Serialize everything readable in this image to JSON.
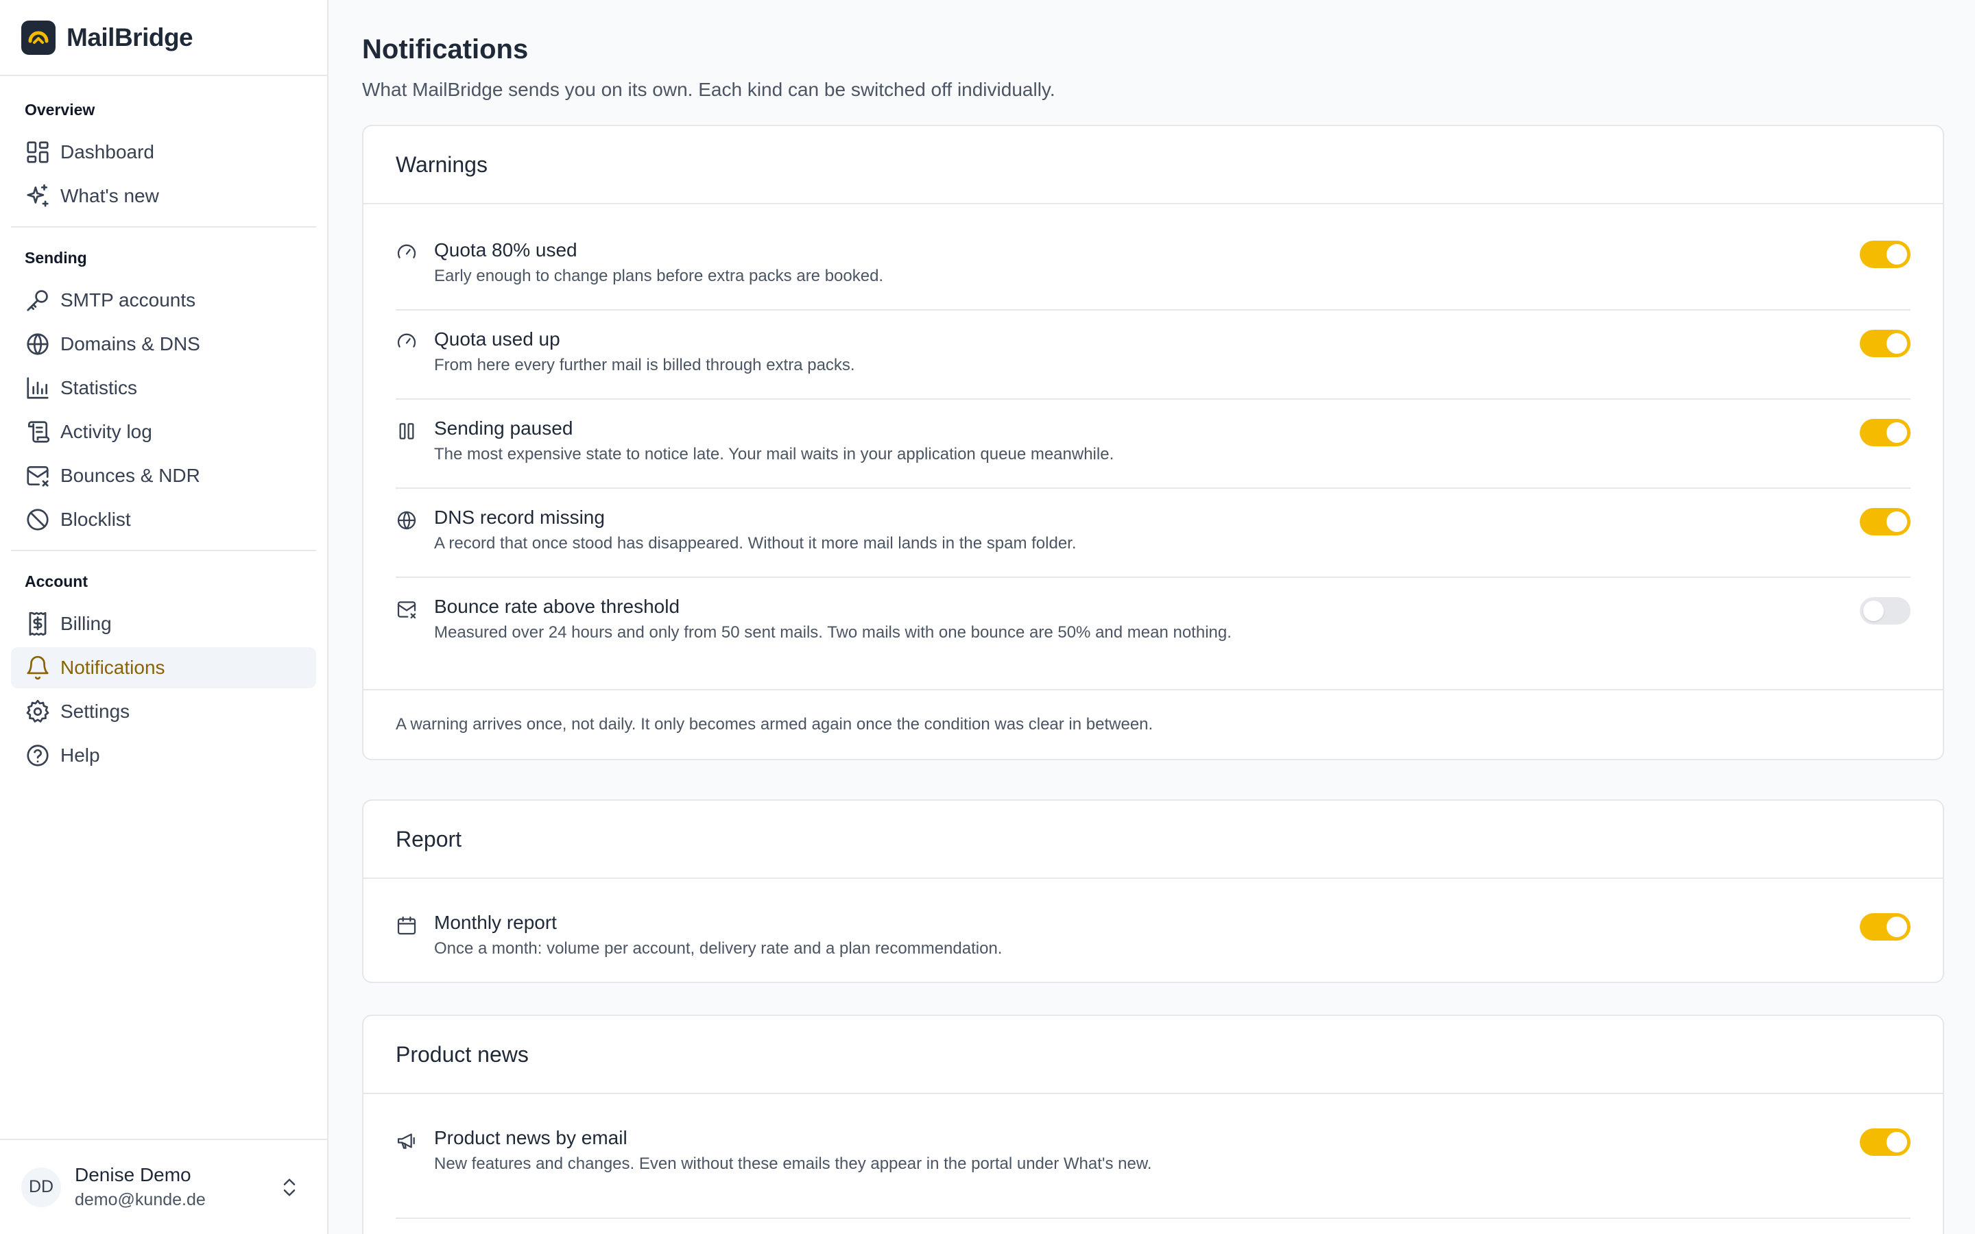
{
  "brand": {
    "name": "MailBridge",
    "accent": "#f5bb00"
  },
  "sidebar": {
    "sections": [
      {
        "heading": "Overview",
        "items": [
          {
            "label": "Dashboard",
            "icon": "dashboard-icon"
          },
          {
            "label": "What's new",
            "icon": "sparkles-icon"
          }
        ]
      },
      {
        "heading": "Sending",
        "items": [
          {
            "label": "SMTP accounts",
            "icon": "key-icon"
          },
          {
            "label": "Domains & DNS",
            "icon": "globe-icon"
          },
          {
            "label": "Statistics",
            "icon": "bar-chart-icon"
          },
          {
            "label": "Activity log",
            "icon": "scroll-icon"
          },
          {
            "label": "Bounces & NDR",
            "icon": "mail-x-icon"
          },
          {
            "label": "Blocklist",
            "icon": "ban-icon"
          }
        ]
      },
      {
        "heading": "Account",
        "items": [
          {
            "label": "Billing",
            "icon": "receipt-dollar-icon"
          },
          {
            "label": "Notifications",
            "icon": "bell-icon",
            "active": true
          },
          {
            "label": "Settings",
            "icon": "gear-icon"
          },
          {
            "label": "Help",
            "icon": "help-circle-icon"
          }
        ]
      }
    ]
  },
  "user": {
    "initials": "DD",
    "name": "Denise Demo",
    "email": "demo@kunde.de"
  },
  "page": {
    "title": "Notifications",
    "subtitle": "What MailBridge sends you on its own. Each kind can be switched off individually."
  },
  "warnings": {
    "title": "Warnings",
    "rows": [
      {
        "title": "Quota 80% used",
        "desc": "Early enough to change plans before extra packs are booked.",
        "icon": "gauge-icon",
        "enabled": true
      },
      {
        "title": "Quota used up",
        "desc": "From here every further mail is billed through extra packs.",
        "icon": "gauge-icon",
        "enabled": true
      },
      {
        "title": "Sending paused",
        "desc": "The most expensive state to notice late. Your mail waits in your application queue meanwhile.",
        "icon": "pause-icon",
        "enabled": true
      },
      {
        "title": "DNS record missing",
        "desc": "A record that once stood has disappeared. Without it more mail lands in the spam folder.",
        "icon": "globe-icon",
        "enabled": true
      },
      {
        "title": "Bounce rate above threshold",
        "desc": "Measured over 24 hours and only from 50 sent mails. Two mails with one bounce are 50% and mean nothing.",
        "icon": "mail-x-icon",
        "enabled": false
      }
    ],
    "footnote": "A warning arrives once, not daily. It only becomes armed again once the condition was clear in between."
  },
  "report": {
    "title": "Report",
    "rows": [
      {
        "title": "Monthly report",
        "desc": "Once a month: volume per account, delivery rate and a plan recommendation.",
        "icon": "calendar-icon",
        "enabled": true
      }
    ]
  },
  "news": {
    "title": "Product news",
    "rows": [
      {
        "title": "Product news by email",
        "desc": "New features and changes. Even without these emails they appear in the portal under What's new.",
        "icon": "megaphone-icon",
        "enabled": true
      }
    ]
  }
}
